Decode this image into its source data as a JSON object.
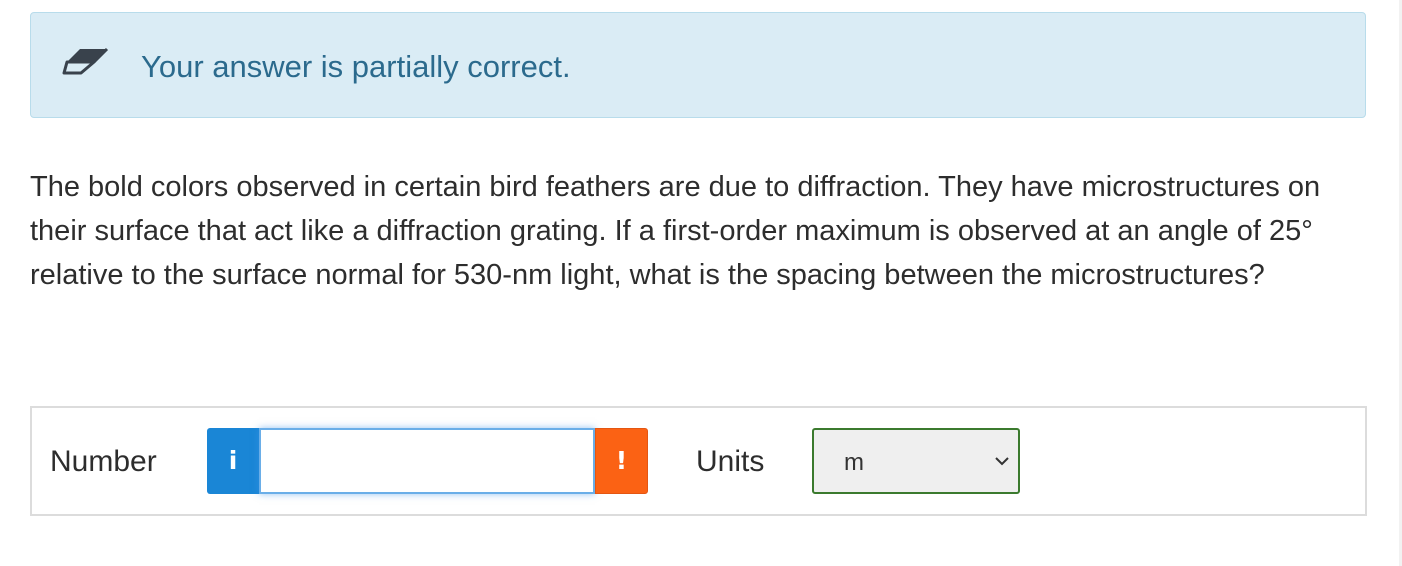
{
  "feedback": {
    "icon": "eraser-icon",
    "message": "Your answer is partially correct.",
    "background_color": "#daecf5",
    "text_color": "#2b6a8d"
  },
  "question": {
    "text": "The bold colors observed in certain bird feathers are due to diffraction. They have microstructures on their surface that act like a diffraction grating. If a first-order maximum is observed at an angle of 25° relative to the surface normal for 530-nm light, what is the spacing between the microstructures?"
  },
  "answer": {
    "number_label": "Number",
    "info_button": {
      "icon": "info-icon",
      "label": "i",
      "color": "#1a86d6"
    },
    "number_input": {
      "value": "",
      "placeholder": ""
    },
    "warning_button": {
      "icon": "exclamation-icon",
      "label": "!",
      "color": "#fb6214"
    },
    "units_label": "Units",
    "units_select": {
      "selected": "m",
      "icon": "chevron-down-icon",
      "border_color": "#3b7a2e"
    }
  }
}
